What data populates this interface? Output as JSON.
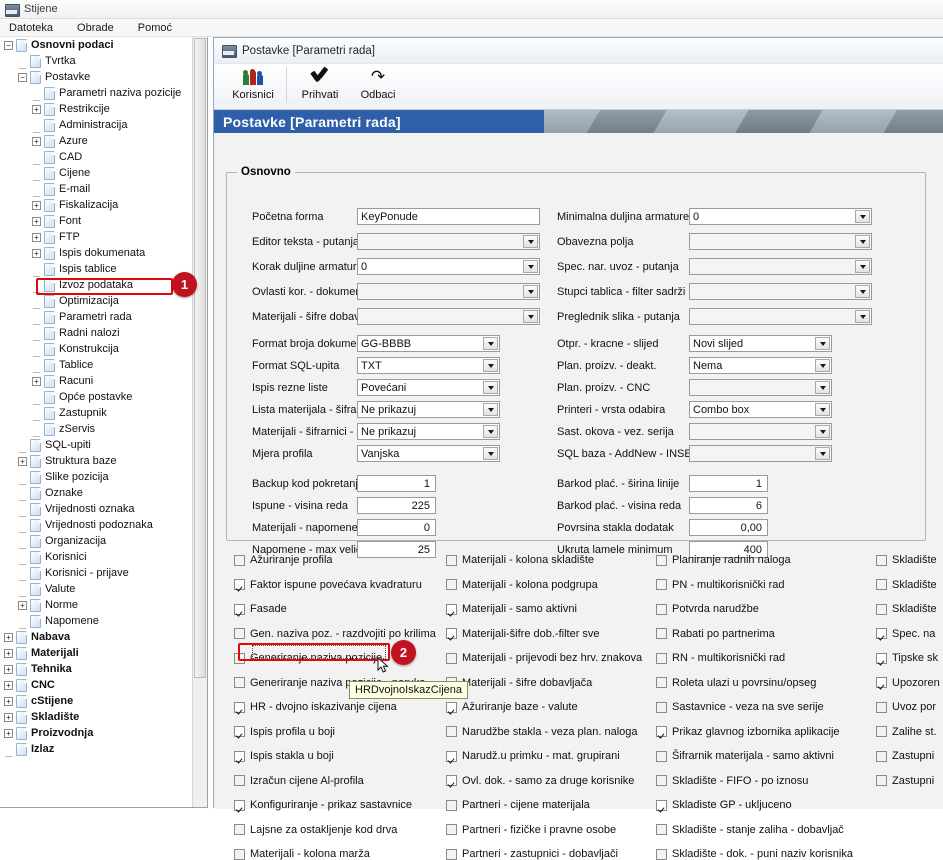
{
  "app": {
    "title": "Stijene",
    "icon": "app-window-icon",
    "menu": [
      "Datoteka",
      "Obrade",
      "Pomoć"
    ]
  },
  "tree": [
    {
      "label": "Osnovni podaci",
      "depth": 0,
      "bold": true,
      "toggle": "minus"
    },
    {
      "label": "Tvrtka",
      "depth": 1,
      "bold": false,
      "toggle": "dash"
    },
    {
      "label": "Postavke",
      "depth": 1,
      "bold": false,
      "toggle": "minus"
    },
    {
      "label": "Parametri naziva pozicije",
      "depth": 2,
      "bold": false,
      "toggle": "dash"
    },
    {
      "label": "Restrikcije",
      "depth": 2,
      "bold": false,
      "toggle": "plus"
    },
    {
      "label": "Administracija",
      "depth": 2,
      "bold": false,
      "toggle": "dash"
    },
    {
      "label": "Azure",
      "depth": 2,
      "bold": false,
      "toggle": "plus"
    },
    {
      "label": "CAD",
      "depth": 2,
      "bold": false,
      "toggle": "dash"
    },
    {
      "label": "Cijene",
      "depth": 2,
      "bold": false,
      "toggle": "dash"
    },
    {
      "label": "E-mail",
      "depth": 2,
      "bold": false,
      "toggle": "dash"
    },
    {
      "label": "Fiskalizacija",
      "depth": 2,
      "bold": false,
      "toggle": "plus"
    },
    {
      "label": "Font",
      "depth": 2,
      "bold": false,
      "toggle": "plus"
    },
    {
      "label": "FTP",
      "depth": 2,
      "bold": false,
      "toggle": "plus"
    },
    {
      "label": "Ispis dokumenata",
      "depth": 2,
      "bold": false,
      "toggle": "plus"
    },
    {
      "label": "Ispis tablice",
      "depth": 2,
      "bold": false,
      "toggle": "dash"
    },
    {
      "label": "Izvoz podataka",
      "depth": 2,
      "bold": false,
      "toggle": "dash"
    },
    {
      "label": "Optimizacija",
      "depth": 2,
      "bold": false,
      "toggle": "dash"
    },
    {
      "label": "Parametri rada",
      "depth": 2,
      "bold": false,
      "toggle": "dash",
      "selected": true
    },
    {
      "label": "Radni nalozi",
      "depth": 2,
      "bold": false,
      "toggle": "dash"
    },
    {
      "label": "Konstrukcija",
      "depth": 2,
      "bold": false,
      "toggle": "dash"
    },
    {
      "label": "Tablice",
      "depth": 2,
      "bold": false,
      "toggle": "dash"
    },
    {
      "label": "Racuni",
      "depth": 2,
      "bold": false,
      "toggle": "plus"
    },
    {
      "label": "Opće postavke",
      "depth": 2,
      "bold": false,
      "toggle": "dash"
    },
    {
      "label": "Zastupnik",
      "depth": 2,
      "bold": false,
      "toggle": "dash"
    },
    {
      "label": "zServis",
      "depth": 2,
      "bold": false,
      "toggle": "dash"
    },
    {
      "label": "SQL-upiti",
      "depth": 1,
      "bold": false,
      "toggle": "dash"
    },
    {
      "label": "Struktura baze",
      "depth": 1,
      "bold": false,
      "toggle": "plus"
    },
    {
      "label": "Slike pozicija",
      "depth": 1,
      "bold": false,
      "toggle": "dash"
    },
    {
      "label": "Oznake",
      "depth": 1,
      "bold": false,
      "toggle": "dash"
    },
    {
      "label": "Vrijednosti oznaka",
      "depth": 1,
      "bold": false,
      "toggle": "dash"
    },
    {
      "label": "Vrijednosti podoznaka",
      "depth": 1,
      "bold": false,
      "toggle": "dash"
    },
    {
      "label": "Organizacija",
      "depth": 1,
      "bold": false,
      "toggle": "dash"
    },
    {
      "label": "Korisnici",
      "depth": 1,
      "bold": false,
      "toggle": "dash"
    },
    {
      "label": "Korisnici - prijave",
      "depth": 1,
      "bold": false,
      "toggle": "dash"
    },
    {
      "label": "Valute",
      "depth": 1,
      "bold": false,
      "toggle": "dash"
    },
    {
      "label": "Norme",
      "depth": 1,
      "bold": false,
      "toggle": "plus"
    },
    {
      "label": "Napomene",
      "depth": 1,
      "bold": false,
      "toggle": "dash"
    },
    {
      "label": "Nabava",
      "depth": 0,
      "bold": true,
      "toggle": "plus"
    },
    {
      "label": "Materijali",
      "depth": 0,
      "bold": true,
      "toggle": "plus"
    },
    {
      "label": "Tehnika",
      "depth": 0,
      "bold": true,
      "toggle": "plus"
    },
    {
      "label": "CNC",
      "depth": 0,
      "bold": true,
      "toggle": "plus"
    },
    {
      "label": "cStijene",
      "depth": 0,
      "bold": true,
      "toggle": "plus"
    },
    {
      "label": "Skladište",
      "depth": 0,
      "bold": true,
      "toggle": "plus"
    },
    {
      "label": "Proizvodnja",
      "depth": 0,
      "bold": true,
      "toggle": "plus"
    },
    {
      "label": "Izlaz",
      "depth": 0,
      "bold": true,
      "toggle": "dash"
    }
  ],
  "child": {
    "titlebar": "Postavke  [Parametri rada]",
    "banner_caption": "Postavke  [Parametri rada]",
    "toolbar": [
      {
        "label": "Korisnici",
        "icon": "users-icon"
      },
      {
        "label": "Prihvati",
        "icon": "check-icon"
      },
      {
        "label": "Odbaci",
        "icon": "undo-icon"
      }
    ]
  },
  "group": {
    "legend": "Osnovno"
  },
  "fields_left_top": [
    {
      "label": "Početna forma",
      "value": "KeyPonude",
      "type": "text"
    },
    {
      "label": "Editor teksta - putanja",
      "value": "",
      "type": "combo"
    },
    {
      "label": "Korak duljine armature",
      "value": "0",
      "type": "combo"
    },
    {
      "label": "Ovlasti kor. - dokumenti",
      "value": "",
      "type": "combo"
    },
    {
      "label": "Materijali - šifre dobavljača",
      "value": "",
      "type": "combo"
    }
  ],
  "fields_right_top": [
    {
      "label": "Minimalna duljina armature",
      "value": "0",
      "type": "combo"
    },
    {
      "label": "Obavezna polja",
      "value": "",
      "type": "combo"
    },
    {
      "label": "Spec. nar. uvoz - putanja",
      "value": "",
      "type": "combo"
    },
    {
      "label": "Stupci tablica - filter sadrži",
      "value": "",
      "type": "combo"
    },
    {
      "label": "Preglednik slika - putanja",
      "value": "",
      "type": "combo"
    }
  ],
  "fields_left_mid": [
    {
      "label": "Format broja dokumenta",
      "value": "GG-BBBB",
      "type": "combo"
    },
    {
      "label": "Format SQL-upita",
      "value": "TXT",
      "type": "combo"
    },
    {
      "label": "Ispis rezne liste",
      "value": "Povećani",
      "type": "combo"
    },
    {
      "label": "Lista materijala - šifra",
      "value": "Ne prikazuj",
      "type": "combo"
    },
    {
      "label": "Materijali - šifrarnici - opis",
      "value": "Ne prikazuj",
      "type": "combo"
    },
    {
      "label": "Mjera profila",
      "value": "Vanjska",
      "type": "combo"
    }
  ],
  "fields_right_mid": [
    {
      "label": "Otpr. - kracne - slijed",
      "value": "Novi slijed",
      "type": "combo"
    },
    {
      "label": "Plan. proizv. - deakt.",
      "value": "Nema",
      "type": "combo"
    },
    {
      "label": "Plan. proizv. - CNC",
      "value": "",
      "type": "combo"
    },
    {
      "label": "Printeri - vrsta odabira",
      "value": "Combo box",
      "type": "combo"
    },
    {
      "label": "Sast. okova - vez. serija",
      "value": "",
      "type": "combo"
    },
    {
      "label": "SQL baza - AddNew - INSERT",
      "value": "",
      "type": "combo"
    }
  ],
  "fields_left_num": [
    {
      "label": "Backup kod pokretanja",
      "value": "1"
    },
    {
      "label": "Ispune - visina reda",
      "value": "225"
    },
    {
      "label": "Materijali - napomene",
      "value": "0"
    },
    {
      "label": "Napomene - max veličina",
      "value": "25"
    }
  ],
  "fields_right_num": [
    {
      "label": "Barkod plać. - širina linije",
      "value": "1"
    },
    {
      "label": "Barkod plać. - visina reda",
      "value": "6"
    },
    {
      "label": "Povrsina stakla dodatak",
      "value": "0,00"
    },
    {
      "label": "Ukruta lamele minimum",
      "value": "400"
    }
  ],
  "checkbox_columns": [
    [
      {
        "label": "Ažuriranje profila",
        "checked": false
      },
      {
        "label": "Faktor ispune povećava kvadraturu",
        "checked": true
      },
      {
        "label": "Fasade",
        "checked": true
      },
      {
        "label": "Gen. naziva poz. - razdvojiti po krilima",
        "checked": false
      },
      {
        "label": "Generiranje naziva pozicije",
        "checked": false
      },
      {
        "label": "Generiranje naziva pozicije - poruka",
        "checked": false
      },
      {
        "label": "HR - dvojno iskazivanje cijena",
        "checked": true,
        "highlighted": true
      },
      {
        "label": "Ispis profila u boji",
        "checked": true
      },
      {
        "label": "Ispis stakla u boji",
        "checked": true
      },
      {
        "label": "Izračun cijene Al-profila",
        "checked": false
      },
      {
        "label": "Konfiguriranje - prikaz sastavnice",
        "checked": true
      },
      {
        "label": "Lajsne za ostakljenje kod drva",
        "checked": false
      },
      {
        "label": "Materijali - kolona marža",
        "checked": false
      }
    ],
    [
      {
        "label": "Materijali - kolona skladište",
        "checked": false
      },
      {
        "label": "Materijali - kolona podgrupa",
        "checked": false
      },
      {
        "label": "Materijali - samo aktivni",
        "checked": true
      },
      {
        "label": "Materijali-šifre dob.-filter sve",
        "checked": true
      },
      {
        "label": "Materijali - prijevodi bez hrv. znakova",
        "checked": false
      },
      {
        "label": "Materijali - šifre dobavljača",
        "checked": false
      },
      {
        "label": "Ažuriranje baze - valute",
        "checked": true
      },
      {
        "label": "Narudžbe stakla - veza plan. naloga",
        "checked": false
      },
      {
        "label": "Narudž.u primku - mat. grupirani",
        "checked": true
      },
      {
        "label": "Ovl. dok. - samo za druge korisnike",
        "checked": true
      },
      {
        "label": "Partneri - cijene materijala",
        "checked": false
      },
      {
        "label": "Partneri - fizičke i pravne osobe",
        "checked": false
      },
      {
        "label": "Partneri - zastupnici - dobavljači",
        "checked": false
      }
    ],
    [
      {
        "label": "Planiranje radnih naloga",
        "checked": false
      },
      {
        "label": "PN - multikorisnički rad",
        "checked": false
      },
      {
        "label": "Potvrda narudžbe",
        "checked": false
      },
      {
        "label": "Rabati po partnerima",
        "checked": false
      },
      {
        "label": "RN - multikorisnički rad",
        "checked": false
      },
      {
        "label": "Roleta ulazi u povrsinu/opseg",
        "checked": false
      },
      {
        "label": "Sastavnice - veza na sve serije",
        "checked": false
      },
      {
        "label": "Prikaz glavnog izbornika aplikacije",
        "checked": true
      },
      {
        "label": "Šifrarnik materijala - samo aktivni",
        "checked": false
      },
      {
        "label": "Skladište - FIFO - po iznosu",
        "checked": false
      },
      {
        "label": "Skladiste GP - ukljuceno",
        "checked": true
      },
      {
        "label": "Skladište - stanje zaliha - dobavljač",
        "checked": false
      },
      {
        "label": "Skladište - dok. - puni naziv korisnika",
        "checked": false
      }
    ],
    [
      {
        "label": "Skladište",
        "checked": false
      },
      {
        "label": "Skladište",
        "checked": false
      },
      {
        "label": "Skladište",
        "checked": false
      },
      {
        "label": "Spec. na",
        "checked": true
      },
      {
        "label": "Tipske sk",
        "checked": true
      },
      {
        "label": "Upozoren",
        "checked": true
      },
      {
        "label": "Uvoz por",
        "checked": false
      },
      {
        "label": "Zalihe st.",
        "checked": false
      },
      {
        "label": "Zastupni",
        "checked": false
      },
      {
        "label": "Zastupni",
        "checked": false
      }
    ]
  ],
  "annotations": {
    "marker_one": "1",
    "marker_two": "2",
    "tooltip": "HRDvojnoIskazCijena"
  },
  "colors": {
    "marker_red": "#c1121f",
    "highlight_red": "#e0080b",
    "banner_blue": "#2f5fa8"
  }
}
